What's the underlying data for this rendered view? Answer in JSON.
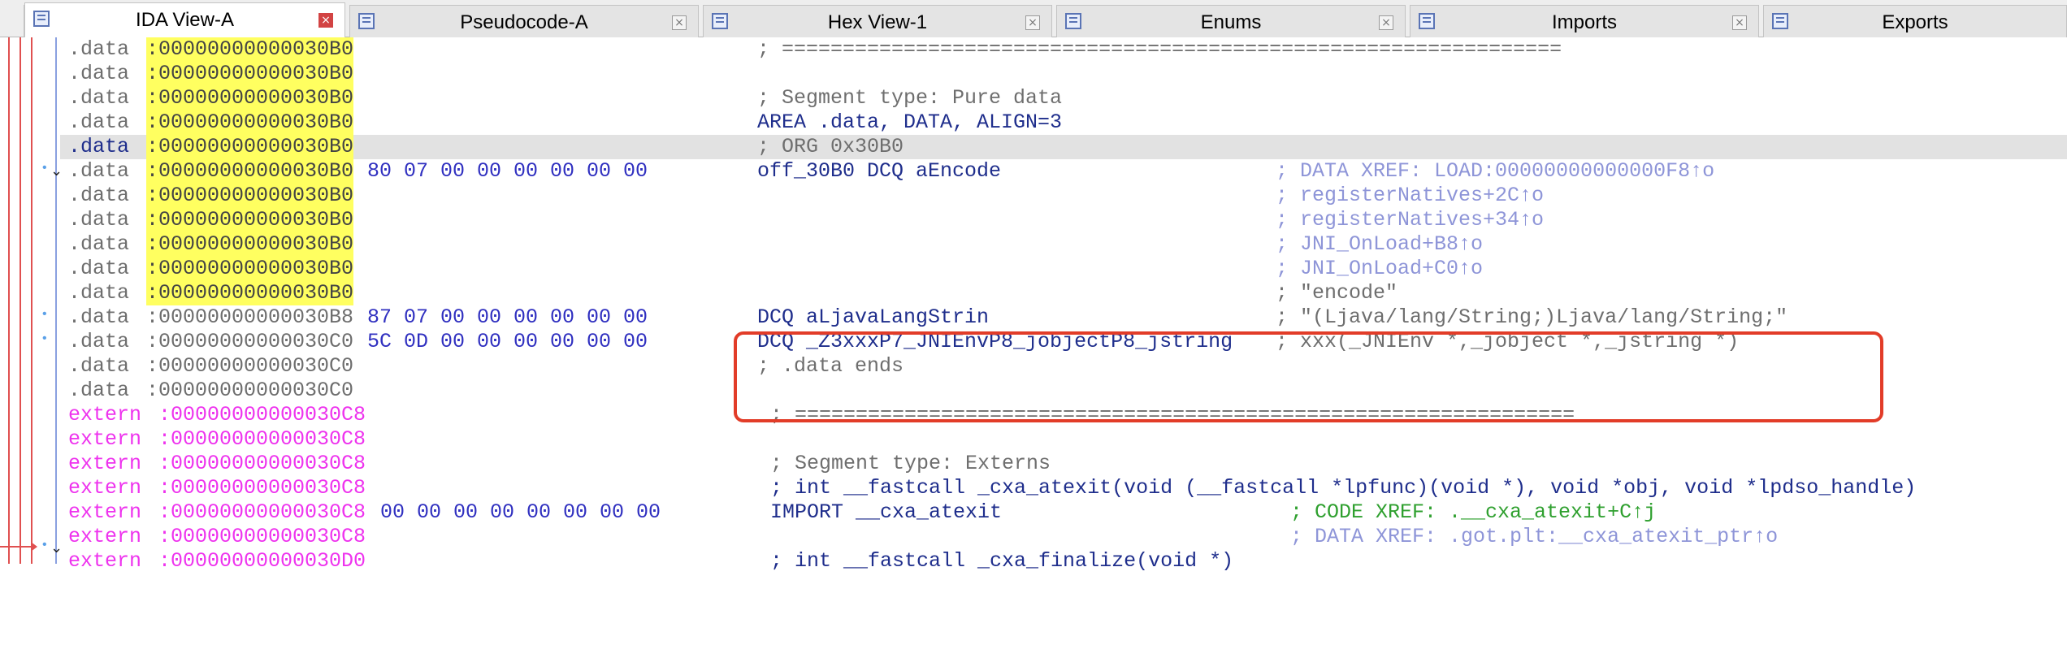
{
  "tabs": [
    {
      "label": "IDA View-A",
      "active": true
    },
    {
      "label": "Pseudocode-A",
      "active": false
    },
    {
      "label": "Hex View-1",
      "active": false
    },
    {
      "label": "Enums",
      "active": false
    },
    {
      "label": "Imports",
      "active": false
    },
    {
      "label": "Exports",
      "active": false
    }
  ],
  "tab_close_glyph": "×",
  "listing": [
    {
      "seg": ".data",
      "addr": ":00000000000030B0",
      "bytes": "",
      "code": "; ================================================================",
      "comment": ""
    },
    {
      "seg": ".data",
      "addr": ":00000000000030B0",
      "bytes": "",
      "code": "",
      "comment": ""
    },
    {
      "seg": ".data",
      "addr": ":00000000000030B0",
      "bytes": "",
      "code": "; Segment type: Pure data",
      "comment": ""
    },
    {
      "seg": ".data",
      "addr": ":00000000000030B0",
      "bytes": "",
      "code": "AREA .data, DATA, ALIGN=3",
      "comment": ""
    },
    {
      "seg": ".data",
      "addr": ":00000000000030B0",
      "bytes": "",
      "code": "; ORG 0x30B0",
      "comment": ""
    },
    {
      "seg": ".data",
      "addr": ":00000000000030B0",
      "bytes": "80 07 00 00 00 00 00 00",
      "code": "off_30B0 DCQ aEncode",
      "comment": "; DATA XREF: LOAD:00000000000000F8↑o"
    },
    {
      "seg": ".data",
      "addr": ":00000000000030B0",
      "bytes": "",
      "code": "",
      "comment": "; registerNatives+2C↑o"
    },
    {
      "seg": ".data",
      "addr": ":00000000000030B0",
      "bytes": "",
      "code": "",
      "comment": "; registerNatives+34↑o"
    },
    {
      "seg": ".data",
      "addr": ":00000000000030B0",
      "bytes": "",
      "code": "",
      "comment": "; JNI_OnLoad+B8↑o"
    },
    {
      "seg": ".data",
      "addr": ":00000000000030B0",
      "bytes": "",
      "code": "",
      "comment": "; JNI_OnLoad+C0↑o"
    },
    {
      "seg": ".data",
      "addr": ":00000000000030B0",
      "bytes": "",
      "code": "",
      "comment": "; \"encode\""
    },
    {
      "seg": ".data",
      "addr": ":00000000000030B8",
      "bytes": "87 07 00 00 00 00 00 00",
      "code": "DCQ aLjavaLangStrin",
      "comment": "; \"(Ljava/lang/String;)Ljava/lang/String;\""
    },
    {
      "seg": ".data",
      "addr": ":00000000000030C0",
      "bytes": "5C 0D 00 00 00 00 00 00",
      "code": "DCQ _Z3xxxP7_JNIEnvP8_jobjectP8_jstring",
      "comment": "; xxx(_JNIEnv *,_jobject *,_jstring *)"
    },
    {
      "seg": ".data",
      "addr": ":00000000000030C0",
      "bytes": "",
      "code": "; .data ends",
      "comment": ""
    },
    {
      "seg": ".data",
      "addr": ":00000000000030C0",
      "bytes": "",
      "code": "",
      "comment": ""
    },
    {
      "seg": "extern",
      "addr": ":00000000000030C8",
      "bytes": "",
      "code": "; ================================================================",
      "comment": ""
    },
    {
      "seg": "extern",
      "addr": ":00000000000030C8",
      "bytes": "",
      "code": "",
      "comment": ""
    },
    {
      "seg": "extern",
      "addr": ":00000000000030C8",
      "bytes": "",
      "code": "; Segment type: Externs",
      "comment": ""
    },
    {
      "seg": "extern",
      "addr": ":00000000000030C8",
      "bytes": "",
      "code": "; int __fastcall _cxa_atexit(void (__fastcall *lpfunc)(void *), void *obj, void *lpdso_handle)",
      "comment": ""
    },
    {
      "seg": "extern",
      "addr": ":00000000000030C8",
      "bytes": "00 00 00 00 00 00 00 00",
      "code": "IMPORT __cxa_atexit",
      "comment": "; CODE XREF: .__cxa_atexit+C↑j"
    },
    {
      "seg": "extern",
      "addr": ":00000000000030C8",
      "bytes": "",
      "code": "",
      "comment": "; DATA XREF: .got.plt:__cxa_atexit_ptr↑o"
    },
    {
      "seg": "extern",
      "addr": ":00000000000030D0",
      "bytes": "",
      "code": "; int __fastcall _cxa_finalize(void *)",
      "comment": ""
    }
  ],
  "colors": {
    "highlight_yellow": "#ffff60",
    "extern_magenta": "#ee33ee",
    "code_navy": "#1f2e8c",
    "xref_lavender": "#8e95d8",
    "arrow_red": "#e05050",
    "box_red": "#e23c28"
  },
  "icons": {
    "tab": "tab-view-icon",
    "fold": "chevron-down-icon",
    "bullet": "bullet-dot-icon"
  }
}
